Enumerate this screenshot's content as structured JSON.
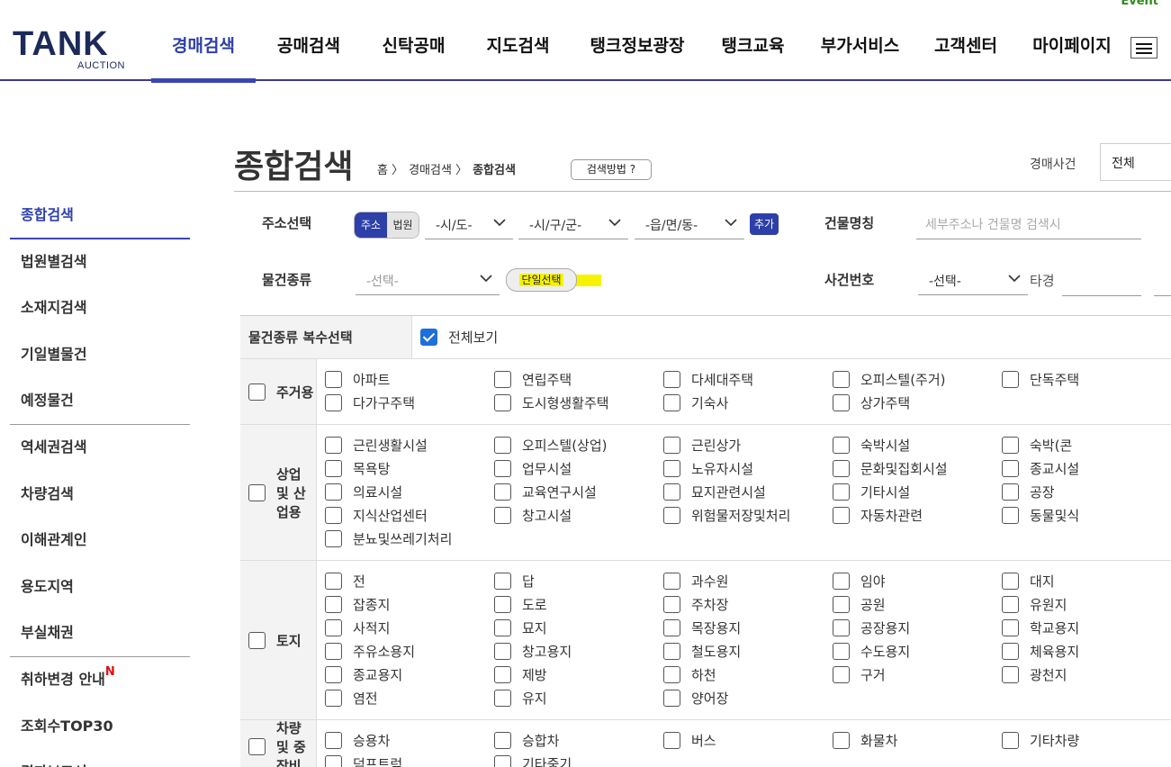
{
  "event_text": "Event",
  "logo": {
    "main": "TANK",
    "sub": "AUCTION"
  },
  "nav": [
    "경매검색",
    "공매검색",
    "신탁공매",
    "지도검색",
    "탱크정보광장",
    "탱크교육",
    "부가서비스",
    "고객센터",
    "마이페이지"
  ],
  "sidebar": [
    "종합검색",
    "법원별검색",
    "소재지검색",
    "기일별물건",
    "예정물건",
    "역세권검색",
    "차량검색",
    "이해관계인",
    "용도지역",
    "부실채권",
    "취하변경 안내",
    "조회수TOP30",
    "결과보고서"
  ],
  "sidebar_new_mark": "N",
  "page": {
    "title": "종합검색",
    "breadcrumb": [
      "홈 〉",
      "경매검색 〉",
      "종합검색"
    ],
    "help_button": "검색방법 ?",
    "case_label": "경매사건",
    "case_select": "전체"
  },
  "form": {
    "address_label": "주소선택",
    "toggle_on": "주소",
    "toggle_off": "법원",
    "sido": "-시/도-",
    "sigungu": "-시/구/군-",
    "eupmyeon": "-읍/면/동-",
    "add_button": "추가",
    "building_label": "건물명칭",
    "building_placeholder": "세부주소나 건물명 검색시",
    "item_type_label": "물건종류",
    "item_type_select": "-선택-",
    "single_select_button": "단일선택",
    "case_number_label": "사건번호",
    "case_number_select": "-선택-",
    "tagyeong": "타경"
  },
  "table": {
    "multi_label": "물건종류 복수선택",
    "view_all": "전체보기",
    "categories": [
      {
        "name": "주거용",
        "items": [
          "아파트",
          "연립주택",
          "다세대주택",
          "오피스텔(주거)",
          "단독주택",
          "다가구주택",
          "도시형생활주택",
          "기숙사",
          "상가주택"
        ]
      },
      {
        "name": "상업 및 산업용",
        "items": [
          "근린생활시설",
          "오피스텔(상업)",
          "근린상가",
          "숙박시설",
          "숙박(콘",
          "목욕탕",
          "업무시설",
          "노유자시설",
          "문화및집회시설",
          "종교시설",
          "의료시설",
          "교육연구시설",
          "묘지관련시설",
          "기타시설",
          "공장",
          "지식산업센터",
          "창고시설",
          "위험물저장및처리",
          "자동차관련",
          "동물및식",
          "분뇨및쓰레기처리"
        ]
      },
      {
        "name": "토지",
        "items": [
          "전",
          "답",
          "과수원",
          "임야",
          "대지",
          "잡종지",
          "도로",
          "주차장",
          "공원",
          "유원지",
          "사적지",
          "묘지",
          "목장용지",
          "공장용지",
          "학교용지",
          "주유소용지",
          "창고용지",
          "철도용지",
          "수도용지",
          "체육용지",
          "종교용지",
          "제방",
          "하천",
          "구거",
          "광천지",
          "염전",
          "유지",
          "양어장"
        ]
      },
      {
        "name": "차량 및 중장비",
        "items": [
          "승용차",
          "승합차",
          "버스",
          "화물차",
          "기타차량",
          "덤프트럭",
          "기타중기"
        ]
      }
    ]
  }
}
